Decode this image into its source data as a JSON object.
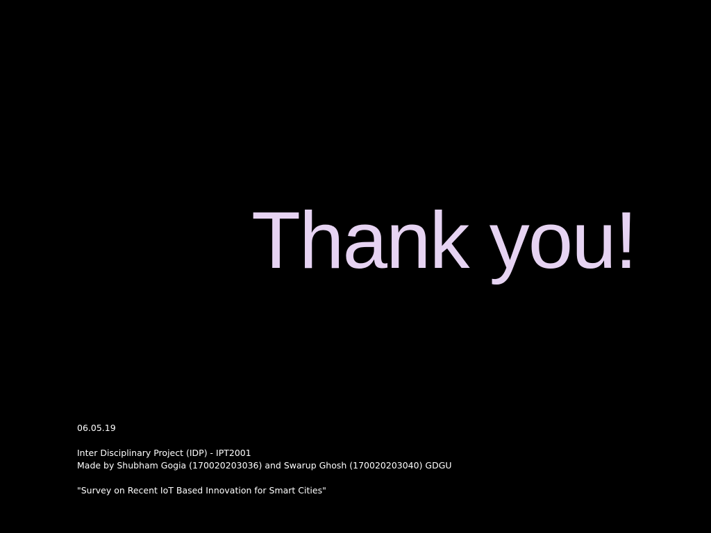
{
  "slide": {
    "title": "Thank you!",
    "footer": {
      "date": "06.05.19",
      "project": "Inter Disciplinary Project (IDP) - IPT2001",
      "authors": "Made by Shubham Gogia (170020203036) and Swarup Ghosh (170020203040) GDGU",
      "topic": "\"Survey on Recent IoT Based Innovation for Smart Cities\""
    }
  },
  "colors": {
    "background": "#000000",
    "title": "#E6D3F2",
    "footer_text": "#FFFFFF"
  }
}
